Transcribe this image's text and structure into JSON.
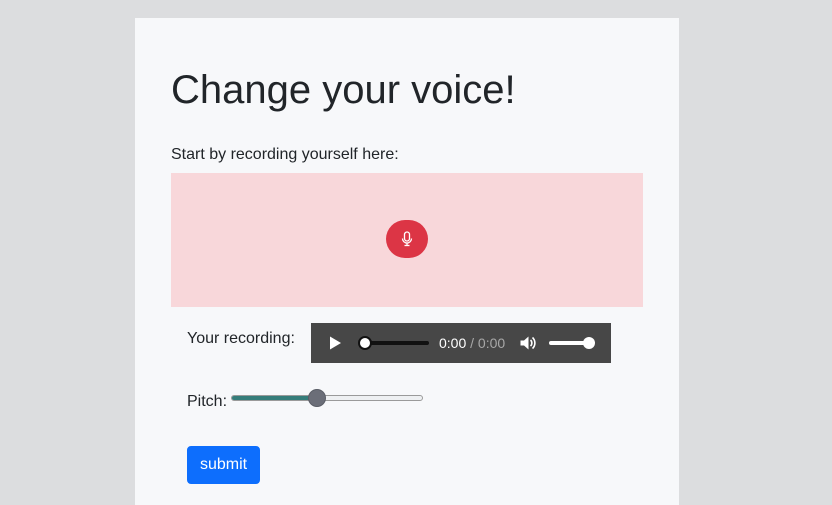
{
  "header": {
    "title": "Change your voice!"
  },
  "recorder": {
    "intro": "Start by recording yourself here:",
    "mic_icon": "microphone-icon",
    "background_color": "#f8d7da",
    "button_color": "#dc3545"
  },
  "playback": {
    "label": "Your recording:",
    "current_time": "0:00",
    "separator": "/",
    "total_time": "0:00",
    "play_icon": "play-icon",
    "volume_icon": "volume-icon",
    "progress": 0,
    "volume": 1
  },
  "pitch": {
    "label": "Pitch:",
    "value_fraction": 0.45,
    "accent_color": "#357d7a"
  },
  "actions": {
    "submit_label": "submit",
    "submit_color": "#0d6efd"
  }
}
